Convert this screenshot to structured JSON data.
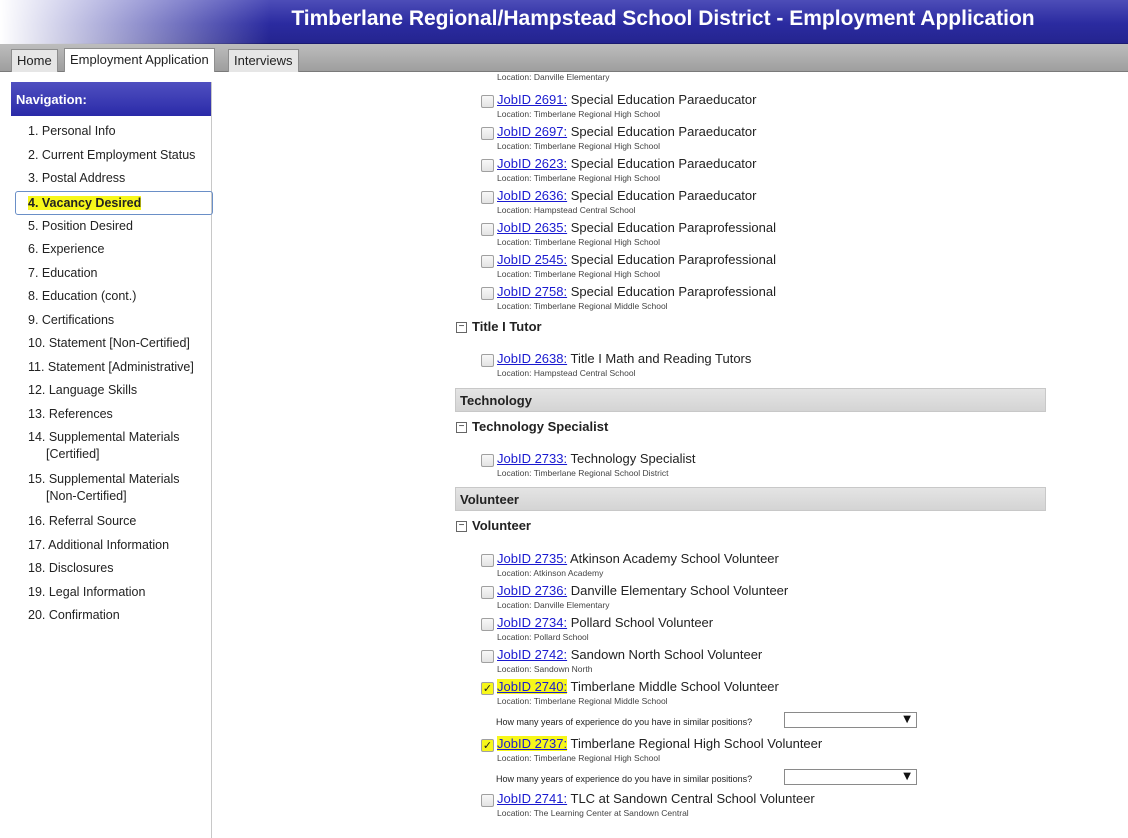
{
  "header": {
    "title": "Timberlane Regional/Hampstead School District - Employment Application"
  },
  "tabs": [
    {
      "label": "Home"
    },
    {
      "label": "Employment Application"
    },
    {
      "label": "Interviews"
    }
  ],
  "navigation": {
    "title": "Navigation:",
    "items": [
      {
        "label": "1. Personal Info"
      },
      {
        "label": "2. Current Employment Status"
      },
      {
        "label": "3. Postal Address"
      },
      {
        "label": "4. Vacancy Desired"
      },
      {
        "label": "5. Position Desired"
      },
      {
        "label": "6. Experience"
      },
      {
        "label": "7. Education"
      },
      {
        "label": "8. Education (cont.)"
      },
      {
        "label": "9. Certifications"
      },
      {
        "label": "10. Statement [Non-Certified]"
      },
      {
        "label": "11. Statement [Administrative]"
      },
      {
        "label": "12. Language Skills"
      },
      {
        "label": "13. References"
      },
      {
        "label": "14. Supplemental Materials",
        "cont": "[Certified]"
      },
      {
        "label": "15. Supplemental Materials",
        "cont": "[Non-Certified]"
      },
      {
        "label": "16. Referral Source"
      },
      {
        "label": "17. Additional Information"
      },
      {
        "label": "18. Disclosures"
      },
      {
        "label": "19. Legal Information"
      },
      {
        "label": "20. Confirmation"
      }
    ]
  },
  "content": {
    "clipped_location": "Location: Danville Elementary",
    "question_label": "How many years of experience do you have in similar positions?",
    "jobs": [
      {
        "link": "JobID 2691:",
        "title": "Special Education Paraeducator",
        "location": "Location: Timberlane Regional High School"
      },
      {
        "link": "JobID 2697:",
        "title": "Special Education Paraeducator",
        "location": "Location: Timberlane Regional High School"
      },
      {
        "link": "JobID 2623:",
        "title": "Special Education Paraeducator",
        "location": "Location: Timberlane Regional High School"
      },
      {
        "link": "JobID 2636:",
        "title": "Special Education Paraeducator",
        "location": "Location: Hampstead Central School"
      },
      {
        "link": "JobID 2635:",
        "title": "Special Education Paraprofessional",
        "location": "Location: Timberlane Regional High School"
      },
      {
        "link": "JobID 2545:",
        "title": "Special Education Paraprofessional",
        "location": "Location: Timberlane Regional High School"
      },
      {
        "link": "JobID 2758:",
        "title": "Special Education Paraprofessional",
        "location": "Location: Timberlane Regional Middle School"
      },
      {
        "link": "JobID 2638:",
        "title": "Title I Math and Reading Tutors",
        "location": "Location: Hampstead Central School"
      },
      {
        "link": "JobID 2733:",
        "title": "Technology Specialist",
        "location": "Location: Timberlane Regional School District"
      },
      {
        "link": "JobID 2735:",
        "title": "Atkinson Academy School Volunteer",
        "location": "Location: Atkinson Academy"
      },
      {
        "link": "JobID 2736:",
        "title": "Danville Elementary School Volunteer",
        "location": "Location: Danville Elementary"
      },
      {
        "link": "JobID 2734:",
        "title": "Pollard School Volunteer",
        "location": "Location: Pollard School"
      },
      {
        "link": "JobID 2742:",
        "title": "Sandown North School Volunteer",
        "location": "Location: Sandown North"
      },
      {
        "link": "JobID 2740:",
        "title": "Timberlane Middle School Volunteer",
        "location": "Location: Timberlane Regional Middle School"
      },
      {
        "link": "JobID 2737:",
        "title": "Timberlane Regional High School Volunteer",
        "location": "Location: Timberlane Regional High School"
      },
      {
        "link": "JobID 2741:",
        "title": "TLC at Sandown Central School Volunteer",
        "location": "Location: The Learning Center at Sandown Central"
      }
    ],
    "groups": [
      {
        "label": "Technology"
      },
      {
        "label": "Volunteer"
      }
    ],
    "subgroups": [
      {
        "label": "Title I Tutor"
      },
      {
        "label": "Technology Specialist"
      },
      {
        "label": "Volunteer"
      }
    ]
  }
}
